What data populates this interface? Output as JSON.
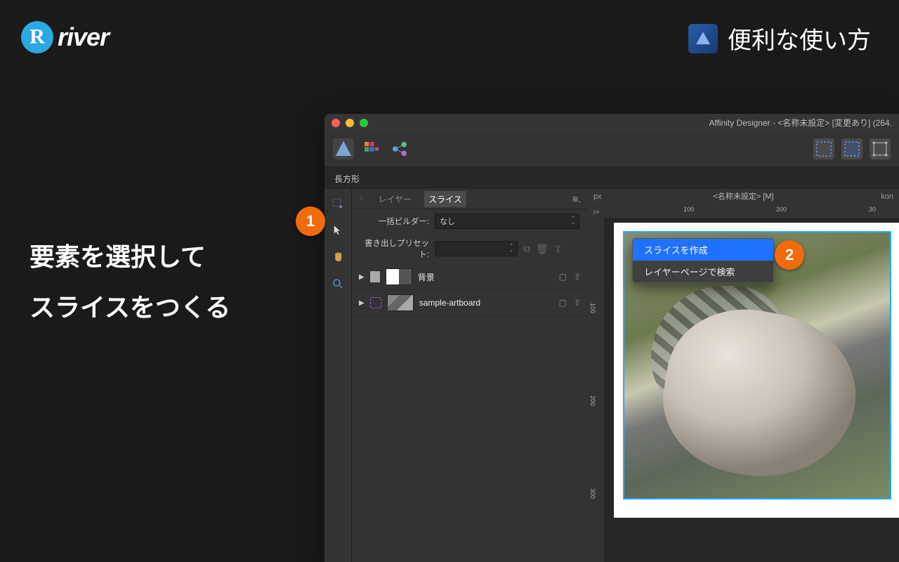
{
  "brand": {
    "name": "river"
  },
  "header_right": {
    "text": "便利な使い方"
  },
  "caption": {
    "line1": "要素を選択して",
    "line2": "スライスをつくる"
  },
  "badges": {
    "one": "1",
    "two": "2"
  },
  "window": {
    "title_text": "Affinity Designer - <名称未設定> [変更あり] (264.",
    "context_label": "長方形",
    "doc_tab_left": "px",
    "doc_tab_center": "<名称未設定> [M]",
    "doc_tab_right": "kon"
  },
  "panel": {
    "tab_layers": "レイヤー",
    "tab_slices": "スライス",
    "builder_label": "一括ビルダー:",
    "builder_value": "なし",
    "preset_label": "書き出しプリセット:",
    "preset_value": "",
    "layers": [
      {
        "name": "背景"
      },
      {
        "name": "sample-artboard"
      }
    ]
  },
  "ruler": {
    "px": "px",
    "h": {
      "t100": "100",
      "t200": "200",
      "t300": "30"
    },
    "v": {
      "t100": "100",
      "t200": "200",
      "t300": "300"
    }
  },
  "context_menu": {
    "create_slice": "スライスを作成",
    "find_in_layers": "レイヤーページで検索"
  }
}
